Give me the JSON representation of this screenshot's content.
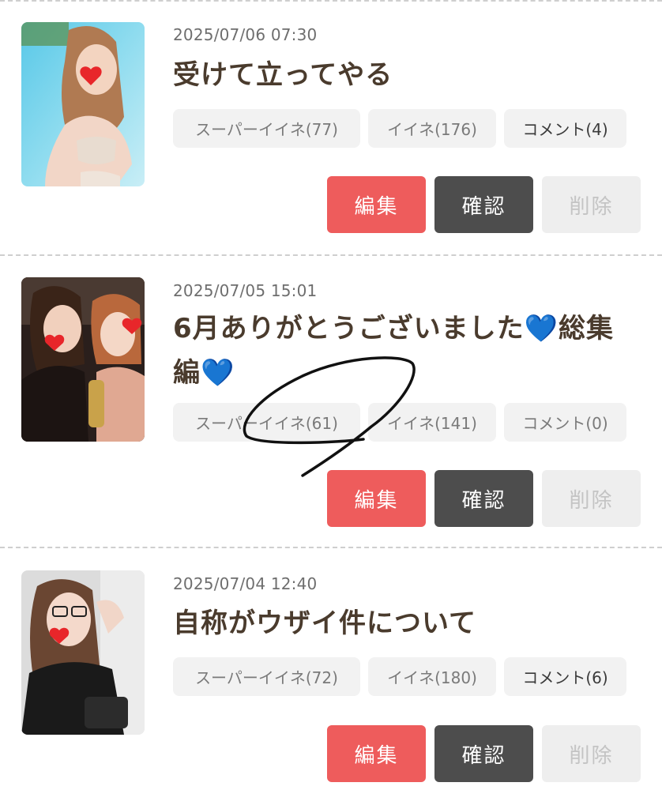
{
  "posts": [
    {
      "date": "2025/07/06 07:30",
      "title": "受けて立ってやる",
      "super_like": "スーパーイイネ(77)",
      "like": "イイネ(176)",
      "comment": "コメント(4)",
      "edit_label": "編集",
      "confirm_label": "確認",
      "delete_label": "削除",
      "thumbnail_icon": "photo-woman-swimsuit"
    },
    {
      "date": "2025/07/05 15:01",
      "title": "6月ありがとうございました💙総集編💙",
      "super_like": "スーパーイイネ(61)",
      "like": "イイネ(141)",
      "comment": "コメント(0)",
      "edit_label": "編集",
      "confirm_label": "確認",
      "delete_label": "削除",
      "thumbnail_icon": "photo-two-women"
    },
    {
      "date": "2025/07/04 12:40",
      "title": "自称がウザイ件について",
      "super_like": "スーパーイイネ(72)",
      "like": "イイネ(180)",
      "comment": "コメント(6)",
      "edit_label": "編集",
      "confirm_label": "確認",
      "delete_label": "削除",
      "thumbnail_icon": "photo-woman-glasses"
    }
  ],
  "colors": {
    "edit": "#ee5c5c",
    "confirm": "#4d4d4d",
    "delete_bg": "#eeeeee",
    "title": "#4a3b2d"
  }
}
